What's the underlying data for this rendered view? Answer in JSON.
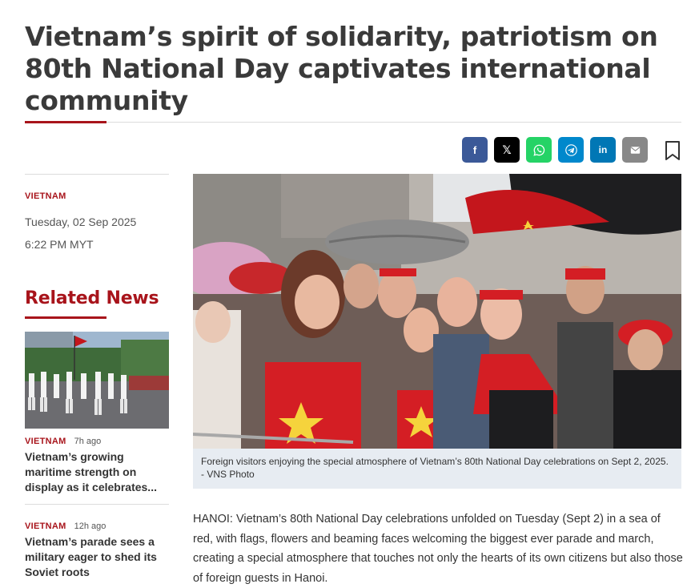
{
  "article": {
    "title": "Vietnam’s spirit of solidarity, patriotism on 80th National Day captivates international community",
    "section": "VIETNAM",
    "date": "Tuesday, 02 Sep 2025",
    "time": "6:22 PM MYT",
    "caption": "Foreign visitors enjoying the special atmosphere of Vietnam’s 80th National Day celebrations on Sept 2, 2025. - VNS Photo",
    "body": "HANOI: Vietnam’s 80th National Day celebrations unfolded on Tuesday (Sept 2) in a sea of red, with flags, flowers and beaming faces welcoming the biggest ever parade and march, creating a special atmosphere that touches not only the hearts of its own citizens but also those of foreign guests in Hanoi."
  },
  "share": {
    "facebook": {
      "glyph": "f",
      "color": "#3b5998",
      "icon": "facebook-icon"
    },
    "x": {
      "glyph": "𝕏",
      "color": "#000000",
      "icon": "x-icon"
    },
    "whatsapp": {
      "color": "#25d366",
      "icon": "whatsapp-icon"
    },
    "telegram": {
      "color": "#0088cc",
      "icon": "telegram-icon"
    },
    "linkedin": {
      "glyph": "in",
      "color": "#0077b5",
      "icon": "linkedin-icon"
    },
    "email": {
      "color": "#888888",
      "icon": "email-icon"
    },
    "bookmark": {
      "icon": "bookmark-icon"
    }
  },
  "related": {
    "heading": "Related News",
    "items": [
      {
        "category": "VIETNAM",
        "ago": "7h ago",
        "headline": "Vietnam’s growing maritime strength on display as it celebrates..."
      },
      {
        "category": "VIETNAM",
        "ago": "12h ago",
        "headline": "Vietnam’s parade sees a military eager to shed its Soviet roots"
      }
    ]
  },
  "colors": {
    "accent": "#a8141b",
    "caption_bg": "#e7ecf2"
  }
}
